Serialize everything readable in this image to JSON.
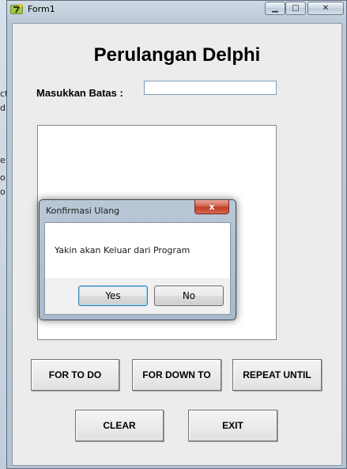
{
  "window": {
    "title": "Form1"
  },
  "controls": {
    "minimize": "▁",
    "maximize": "□",
    "close": "✕"
  },
  "form": {
    "heading": "Perulangan Delphi",
    "batas_label": "Masukkan Batas :",
    "batas_value": "",
    "buttons": {
      "for_to_do": "FOR TO DO",
      "for_down_to": "FOR DOWN TO",
      "repeat_until": "REPEAT UNTIL",
      "clear": "CLEAR",
      "exit": "EXIT"
    }
  },
  "dialog": {
    "title": "Konfirmasi Ulang",
    "close": "x",
    "message": "Yakin akan Keluar dari Program",
    "yes": "Yes",
    "no": "No"
  }
}
